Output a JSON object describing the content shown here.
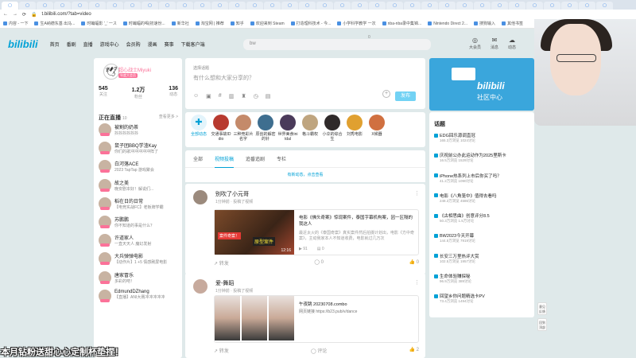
{
  "browser": {
    "url": "t.bilibili.com/?tab=video",
    "tabs_count": 35,
    "bookmarks": [
      "内容 - 一下",
      "生A纳德东基 出马...",
      "时蝙蝠影 '_' 一ス",
      "时蝙蝠的喝(初速份...",
      "新华社",
      "淘宝网 | 推荐",
      "知乎",
      "欢迎来到 Steam",
      "打造理科技术 - 今...",
      "小学科学教学 一次",
      "nba-nba录中集锦...",
      "Nintendo Direct 2...",
      "搜狗输入",
      "其他书签"
    ]
  },
  "topnav": {
    "logo": "bilibili",
    "items": [
      "首页",
      "番剧",
      "直播",
      "游戏中心",
      "会员购",
      "漫画",
      "赛事",
      "下载客户端"
    ],
    "search_placeholder": "bw",
    "right": [
      "大会员",
      "消息",
      "动态"
    ]
  },
  "profile": {
    "name": "超心战士Miyuki",
    "level": "年度大会员",
    "stats": [
      {
        "value": "545",
        "label": "关注"
      },
      {
        "value": "1.2万",
        "label": "粉丝"
      },
      {
        "value": "136",
        "label": "动态"
      }
    ]
  },
  "live": {
    "header": "正在直播",
    "count": "10",
    "more": "查看更多 >",
    "items": [
      {
        "name": "被割的奶茶",
        "desc": "抖抖抖抖抖抖"
      },
      {
        "name": "鼠子团BBQ学渣Kay",
        "desc": "你们的歌冲冲冲冲冲阵了"
      },
      {
        "name": "白河落ACE",
        "desc": "2023 TapTap 游戏聚会"
      },
      {
        "name": "故之美",
        "desc": "晚安剧本好！解说们..."
      },
      {
        "name": "稻在日的日常",
        "desc": "【电竞实战FC】老板牌学霸"
      },
      {
        "name": "苏鹏鹏",
        "desc": "你不知道的事是什么？"
      },
      {
        "name": "许道家人",
        "desc": "一直天天人 魔幻发射"
      },
      {
        "name": "大兵弹弹电影",
        "desc": "【动作片】1 +5 情感刷屏电影"
      },
      {
        "name": "唐家冒乐",
        "desc": "多彩的吧！"
      },
      {
        "name": "EdmundDZhang",
        "desc": "【直播】ANI大赛冲冲冲冲冲"
      }
    ]
  },
  "composer": {
    "vote": "选择话题",
    "placeholder": "有什么想和大家分享的？",
    "count": "0",
    "publish": "发布",
    "tools": [
      "emoji-icon",
      "image-icon",
      "hashtag-icon",
      "chart-icon",
      "bag-icon",
      "clock-icon",
      "layout-icon"
    ]
  },
  "ups": [
    {
      "name": "全部动态",
      "all": true
    },
    {
      "name": "交通事故ID dio"
    },
    {
      "name": "三种竞彩片 名字"
    },
    {
      "name": "原创的解密 的针"
    },
    {
      "name": "世界美食ini tdal"
    },
    {
      "name": "格斗霸权"
    },
    {
      "name": "小伞的综合 生"
    },
    {
      "name": "刘秀电影"
    },
    {
      "name": "X候器"
    }
  ],
  "tabs": [
    "全部",
    "视频投稿",
    "追番追剧",
    "专栏"
  ],
  "new_dynamic": "有新动态，点击查看",
  "cards": [
    {
      "user": "别吹了小元哥",
      "time": "1分钟前 · 投稿了视频",
      "video_title": "电影《佛头奇案》惊现案件，泰国字幕机构案，因一区隔的我这人",
      "video_desc": "最近太火的《泰国奇案》真实案件然后拍摄计划出，电影《方中奇案》，主动我家本人不知道收费，电影就过几万次",
      "views": "91",
      "likes": "0",
      "duration": "12:16",
      "tag1": "案件奇案！",
      "tag2": "原型案件",
      "footer": [
        "转发",
        "评论",
        "点赞"
      ],
      "footer_counts": [
        "",
        "0",
        "0"
      ]
    },
    {
      "user": "爱-舞蹈",
      "time": "1分钟前 · 投稿了视频",
      "video_title": "",
      "img_caption": "午夜跳 20230708.combo",
      "img_link": "网页链接 https://b23.pub/v/dance",
      "footer": [
        "转发",
        "评论",
        "点赞"
      ],
      "footer_counts": [
        "",
        "0",
        "2"
      ]
    }
  ],
  "banner": {
    "logo": "bilibili",
    "label": "社区中心"
  },
  "hot": {
    "title": "话题",
    "items": [
      {
        "title": "EDG回乐源调直冠",
        "meta": "165.3万浏览 1024讨论"
      },
      {
        "title": "庆祝前公办此运动作为2025里斯卡",
        "meta": "16.5万浏览 1529讨论"
      },
      {
        "title": "iPhone热系列上市后你买了吗？",
        "meta": "41.2万浏览 1090讨论"
      },
      {
        "title": "电影《八角笼中》值得去看吗",
        "meta": "248.3万浏览 4586讨论"
      },
      {
        "title": "《古相思曲》创意评分8.5",
        "meta": "50.3万浏览 1.5万讨论"
      },
      {
        "title": "BW2023今天开幕",
        "meta": "144.5万浏览 7919讨论"
      },
      {
        "title": "长安三万里热评大赏",
        "meta": "102.5万浏览 1957讨论"
      },
      {
        "title": "生命体验赚探秘",
        "meta": "96.9万浏览 389讨论"
      },
      {
        "title": "回望乡你问题精选卡PV",
        "meta": "73.4万浏览 1494讨论"
      }
    ]
  },
  "side_buttons": [
    "意见反馈",
    "回到顶部"
  ],
  "subtitle": "本月钻粉送甜心心定制杯垫捏！"
}
